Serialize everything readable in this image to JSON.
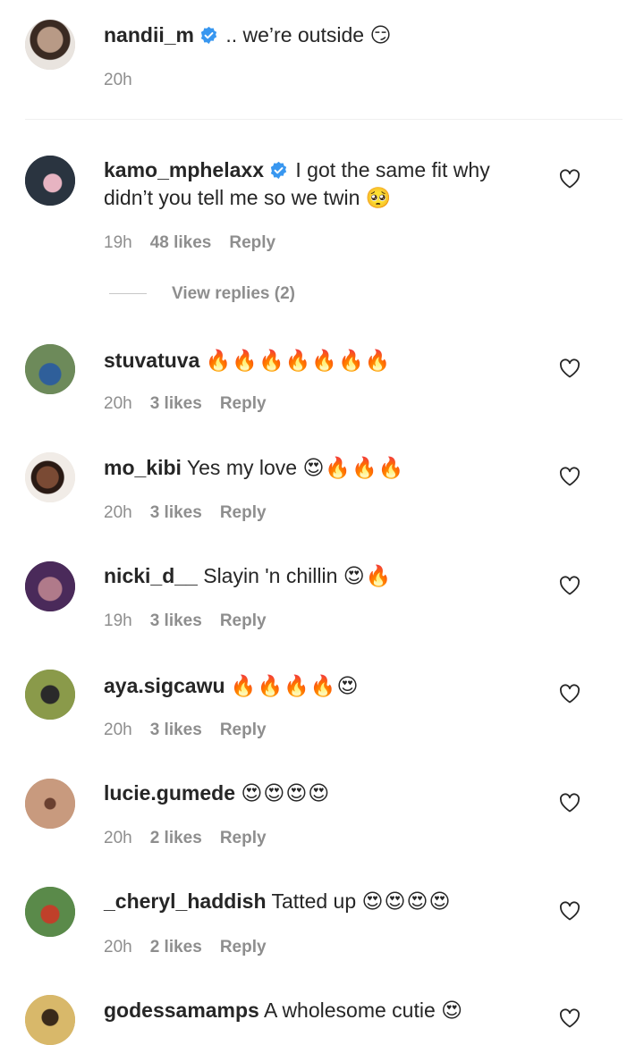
{
  "caption": {
    "username": "nandii_m",
    "verified": true,
    "text": ".. we’re outside",
    "emojis": "😏",
    "time": "20h"
  },
  "comments": [
    {
      "username": "kamo_mphelaxx",
      "verified": true,
      "text": "I got the same fit why didn’t you tell me so we twin",
      "emojis": "🥺",
      "time": "19h",
      "likes": "48 likes",
      "reply": "Reply",
      "view_replies": "View replies (2)"
    },
    {
      "username": "stuvatuva",
      "text": "",
      "emojis": "🔥🔥🔥🔥🔥🔥🔥",
      "time": "20h",
      "likes": "3 likes",
      "reply": "Reply"
    },
    {
      "username": "mo_kibi",
      "text": "Yes my love",
      "emojis": "😍🔥🔥🔥",
      "time": "20h",
      "likes": "3 likes",
      "reply": "Reply"
    },
    {
      "username": "nicki_d__",
      "text": "Slayin 'n chillin",
      "emojis": "😍🔥",
      "time": "19h",
      "likes": "3 likes",
      "reply": "Reply"
    },
    {
      "username": "aya.sigcawu",
      "text": "",
      "emojis": "🔥🔥🔥🔥😍",
      "time": "20h",
      "likes": "3 likes",
      "reply": "Reply"
    },
    {
      "username": "lucie.gumede",
      "text": "",
      "emojis": "😍😍😍😍",
      "time": "20h",
      "likes": "2 likes",
      "reply": "Reply"
    },
    {
      "username": "_cheryl_haddish",
      "text": "Tatted up",
      "emojis": "😍😍😍😍",
      "time": "20h",
      "likes": "2 likes",
      "reply": "Reply"
    },
    {
      "username": "godessamamps",
      "text": "A wholesome cutie",
      "emojis": "😍",
      "time": "",
      "likes": "",
      "reply": ""
    }
  ],
  "colors": {
    "text": "#262626",
    "meta": "#8e8e8e",
    "verified_blue": "#3897f0",
    "divider": "#efefef"
  },
  "icons": {
    "verified": "verified-badge-icon",
    "like": "heart-outline-icon"
  }
}
